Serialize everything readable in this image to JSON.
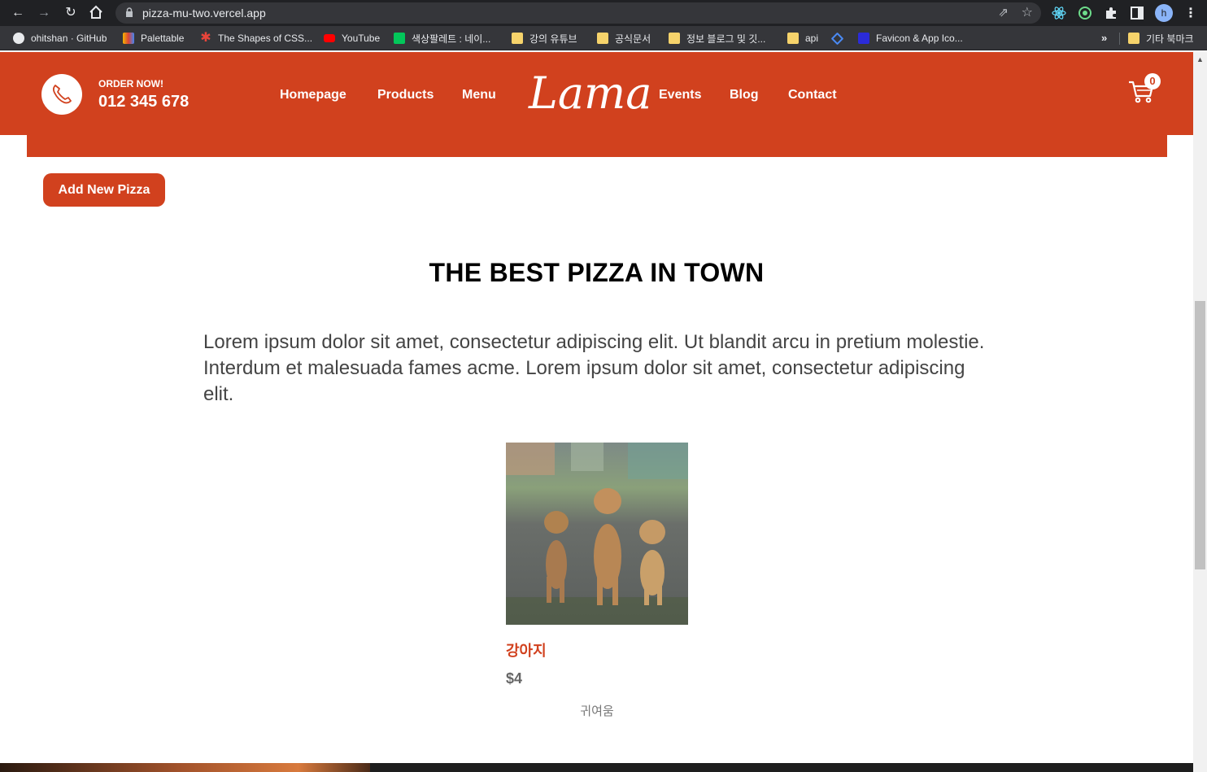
{
  "browser": {
    "url": "pizza-mu-two.vercel.app",
    "avatar_initial": "h",
    "bookmarks": [
      {
        "label": "ohitshan · GitHub"
      },
      {
        "label": "Palettable"
      },
      {
        "label": "The Shapes of CSS..."
      },
      {
        "label": "YouTube"
      },
      {
        "label": "색상팔레트 : 네이..."
      },
      {
        "label": "강의 유튜브"
      },
      {
        "label": "공식문서"
      },
      {
        "label": "정보 블로그 및 깃..."
      },
      {
        "label": "api"
      },
      {
        "label": ""
      },
      {
        "label": "Favicon & App Ico..."
      }
    ],
    "more_label": "»",
    "other_bookmarks": "기타 북마크"
  },
  "navbar": {
    "order_label": "ORDER NOW!",
    "phone": "012 345 678",
    "links_left": [
      "Homepage",
      "Products",
      "Menu"
    ],
    "logo": "Lama",
    "links_right": [
      "Events",
      "Blog",
      "Contact"
    ],
    "cart_count": "0",
    "brand_color": "#d1411e"
  },
  "admin": {
    "add_button": "Add New Pizza"
  },
  "intro": {
    "title": "THE BEST PIZZA IN TOWN",
    "text": "Lorem ipsum dolor sit amet, consectetur adipiscing elit. Ut blandit arcu in pretium molestie. Interdum et malesuada fames acme. Lorem ipsum dolor sit amet, consectetur adipiscing elit."
  },
  "products": [
    {
      "title": "강아지",
      "price": "$4",
      "desc": "귀여움"
    }
  ]
}
